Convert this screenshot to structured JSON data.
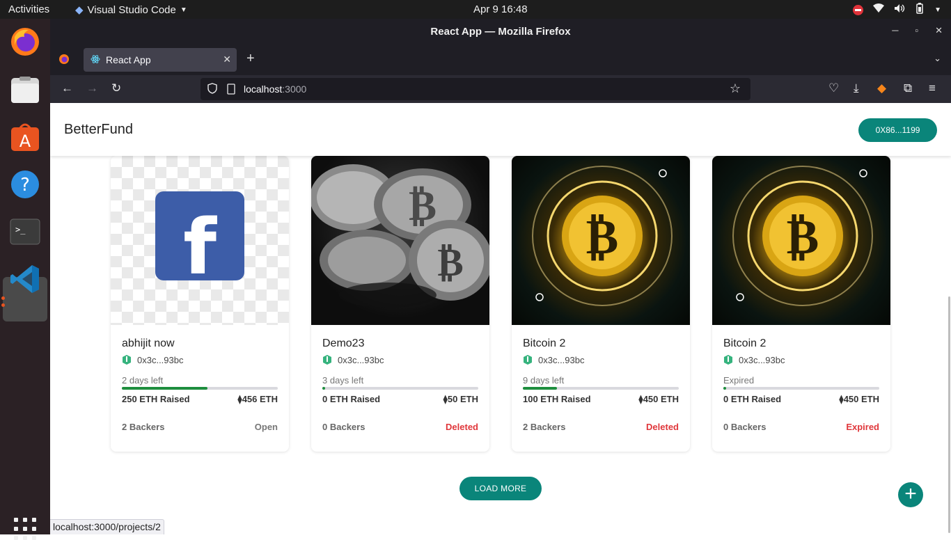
{
  "system": {
    "activities": "Activities",
    "app_name": "Visual Studio Code",
    "clock": "Apr 9  16:48"
  },
  "browser": {
    "window_title": "React App — Mozilla Firefox",
    "tab_title": "React App",
    "url_host": "localhost",
    "url_port": ":3000",
    "status_url": "localhost:3000/projects/2"
  },
  "app": {
    "brand": "BetterFund",
    "wallet": "0X86...1199",
    "load_more": "LOAD MORE",
    "fab": "+"
  },
  "projects": [
    {
      "name": "abhijit now",
      "owner": "0x3c...93bc",
      "time_left": "2 days left",
      "progress": 0.55,
      "raised": "250 ETH Raised",
      "goal": "456 ETH",
      "backers": "2 Backers",
      "status": "Open",
      "status_kind": "open",
      "image": "facebook-logo"
    },
    {
      "name": "Demo23",
      "owner": "0x3c...93bc",
      "time_left": "3 days left",
      "progress": 0.0,
      "raised": "0 ETH Raised",
      "goal": "50 ETH",
      "backers": "0 Backers",
      "status": "Deleted",
      "status_kind": "red",
      "image": "silver-bitcoins"
    },
    {
      "name": "Bitcoin 2",
      "owner": "0x3c...93bc",
      "time_left": "9 days left",
      "progress": 0.22,
      "raised": "100 ETH Raised",
      "goal": "450 ETH",
      "backers": "2 Backers",
      "status": "Deleted",
      "status_kind": "red",
      "image": "gold-bitcoin"
    },
    {
      "name": "Bitcoin 2",
      "owner": "0x3c...93bc",
      "time_left": "Expired",
      "progress": 0.0,
      "raised": "0 ETH Raised",
      "goal": "450 ETH",
      "backers": "0 Backers",
      "status": "Expired",
      "status_kind": "red",
      "image": "gold-bitcoin"
    }
  ],
  "colors": {
    "accent": "#0a857a",
    "progress": "#1e8e3e",
    "danger": "#e0373b"
  }
}
